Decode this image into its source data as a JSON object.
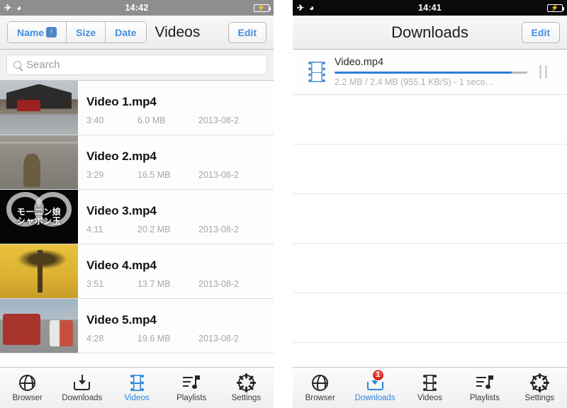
{
  "left_phone": {
    "status_bar": {
      "airplane_icon": "airplane-icon",
      "wifi_icon": "wifi-icon",
      "time": "14:42",
      "battery_icon": "battery-charging-icon"
    },
    "nav": {
      "segments": [
        {
          "label": "Name",
          "sort_badge": "↑",
          "selected": true
        },
        {
          "label": "Size",
          "sort_badge": "",
          "selected": false
        },
        {
          "label": "Date",
          "sort_badge": "",
          "selected": false
        }
      ],
      "title": "Videos",
      "edit_label": "Edit"
    },
    "search": {
      "placeholder": "Search",
      "value": "",
      "icon": "search-icon"
    },
    "videos": [
      {
        "title": "Video 1.mp4",
        "duration": "3:40",
        "size": "6.0 MB",
        "date": "2013-08-2",
        "art": "art1",
        "caption": ""
      },
      {
        "title": "Video 2.mp4",
        "duration": "3:29",
        "size": "16.5 MB",
        "date": "2013-08-2",
        "art": "art2",
        "caption": ""
      },
      {
        "title": "Video 3.mp4",
        "duration": "4:11",
        "size": "20.2 MB",
        "date": "2013-08-2",
        "art": "art3",
        "caption": "モーニン娘\nシャボン玉"
      },
      {
        "title": "Video 4.mp4",
        "duration": "3:51",
        "size": "13.7 MB",
        "date": "2013-08-2",
        "art": "art4",
        "caption": ""
      },
      {
        "title": "Video 5.mp4",
        "duration": "4:28",
        "size": "19.6 MB",
        "date": "2013-08-2",
        "art": "art5",
        "caption": ""
      }
    ],
    "tabs": [
      {
        "label": "Browser",
        "icon": "globe-icon",
        "active": false,
        "badge": ""
      },
      {
        "label": "Downloads",
        "icon": "download-icon",
        "active": false,
        "badge": ""
      },
      {
        "label": "Videos",
        "icon": "film-icon",
        "active": true,
        "badge": ""
      },
      {
        "label": "Playlists",
        "icon": "playlist-icon",
        "active": false,
        "badge": ""
      },
      {
        "label": "Settings",
        "icon": "gear-icon",
        "active": false,
        "badge": ""
      }
    ]
  },
  "right_phone": {
    "status_bar": {
      "airplane_icon": "airplane-icon",
      "wifi_icon": "wifi-icon",
      "time": "14:41",
      "battery_icon": "battery-charging-icon"
    },
    "nav": {
      "title": "Downloads",
      "edit_label": "Edit"
    },
    "download": {
      "file_name": "Video.mp4",
      "status": "2.2 MB / 2.4 MB (955.1 KB/S) - 1 seco…",
      "progress_percent": 92,
      "downloaded": "2.2 MB",
      "total": "2.4 MB",
      "speed": "955.1 KB/S",
      "remaining": "1 seco…",
      "file_icon": "film-icon",
      "pause_icon": "pause-icon"
    },
    "empty_rows": 5,
    "tabs": [
      {
        "label": "Browser",
        "icon": "globe-icon",
        "active": false,
        "badge": ""
      },
      {
        "label": "Downloads",
        "icon": "download-icon",
        "active": true,
        "badge": "1"
      },
      {
        "label": "Videos",
        "icon": "film-icon",
        "active": false,
        "badge": ""
      },
      {
        "label": "Playlists",
        "icon": "playlist-icon",
        "active": false,
        "badge": ""
      },
      {
        "label": "Settings",
        "icon": "gear-icon",
        "active": false,
        "badge": ""
      }
    ]
  },
  "colors": {
    "accent_blue": "#2f86dd",
    "link_blue": "#3f8fe0",
    "badge_red": "#d81f17",
    "progress_blue": "#2f7fd4"
  }
}
